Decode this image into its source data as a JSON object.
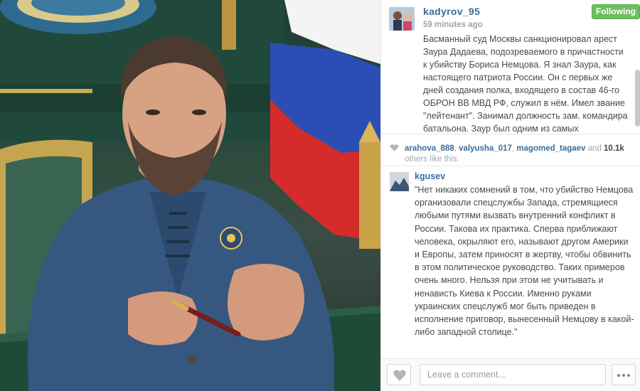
{
  "post": {
    "username": "kadyrov_95",
    "time_ago": "59 minutes ago",
    "follow_label": "Following",
    "caption": "Басманный суд Москвы санкционировал арест Заура Дадаева, подозреваемого в причастности к убийству Бориса Немцова. Я знал Заура, как настоящего патриота России. Он с первых же дней создания полка, входящего в состав 46-го ОБРОН ВВ МВД РФ, служил в нём. Имел звание \"лейтенант\". Занимал должность зам. командира батальона. Заур был одним из самых"
  },
  "likes": {
    "users": [
      "arahova_888",
      "valyusha_017",
      "magomed_tagaev"
    ],
    "separator": ", ",
    "and_text": " and ",
    "count": "10.1k",
    "suffix": " others like this."
  },
  "comment": {
    "username": "kgusev",
    "text": "\"Нет никаких сомнений в том, что убийство Немцова организовали спецслужбы Запада, стремящиеся любыми путями вызвать внутренний конфликт в России. Такова их практика. Сперва приближают человека, окрыляют его, называют другом Америки и Европы, затем приносят в жертву, чтобы обвинить в этом политическое руководство. Таких примеров очень много. Нельзя при этом не учитывать и ненависть Киева к России. Именно руками украинских спецслужб мог быть приведен в исполнение приговор, вынесенный Немцову в какой-либо западной столице.\""
  },
  "footer": {
    "comment_placeholder": "Leave a comment..."
  },
  "icons": {
    "like": "heart-icon",
    "likes_small": "heart-icon",
    "more": "ellipsis-icon"
  },
  "colors": {
    "link": "#3d6d99",
    "following_button": "#6cbf5e",
    "muted_text": "#a3a3a3"
  }
}
